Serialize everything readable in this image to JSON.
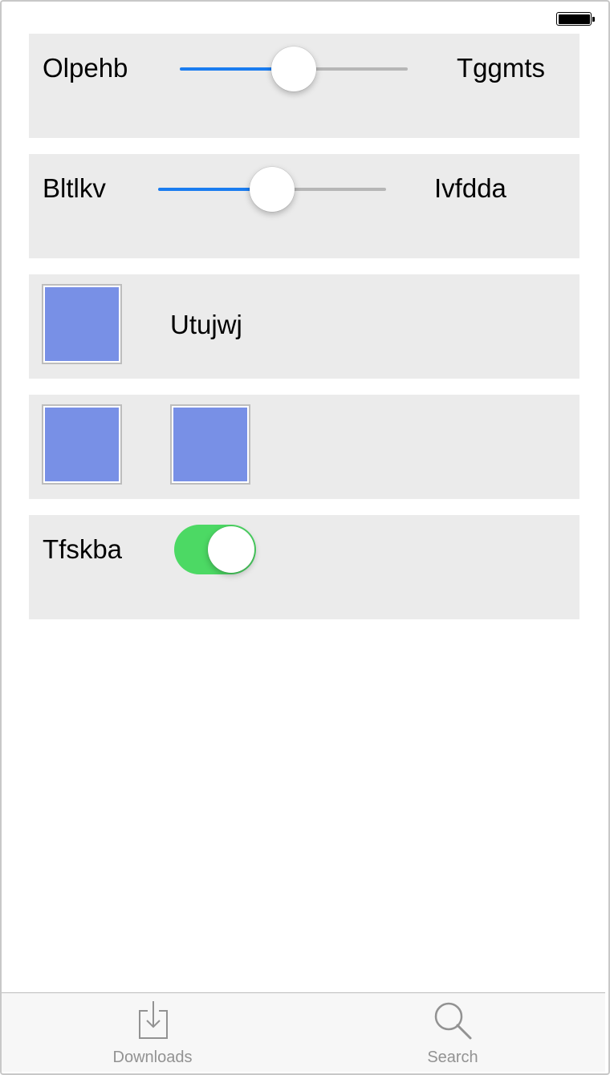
{
  "status_bar": {
    "battery_icon": "battery-icon"
  },
  "rows": {
    "slider_row_1": {
      "left_label": "Olpehb",
      "right_label": "Tggmts",
      "value": 0.5
    },
    "slider_row_2": {
      "left_label": "Bltlkv",
      "right_label": "Ivfdda",
      "value": 0.5
    },
    "swatch_row": {
      "label": "Utujwj",
      "swatch_color": "#7890e6"
    },
    "swatch_pair_row": {
      "swatch_color": "#7890e6"
    },
    "toggle_row": {
      "label": "Tfskba",
      "on": true,
      "on_color": "#4cd964"
    }
  },
  "tab_bar": {
    "items": [
      {
        "label": "Downloads",
        "icon": "downloads-icon"
      },
      {
        "label": "Search",
        "icon": "search-icon"
      }
    ],
    "label_color": "#929292"
  },
  "colors": {
    "accent": "#1a7cf0",
    "row_background": "#ebebeb",
    "track_inactive": "#b6b6b6"
  }
}
